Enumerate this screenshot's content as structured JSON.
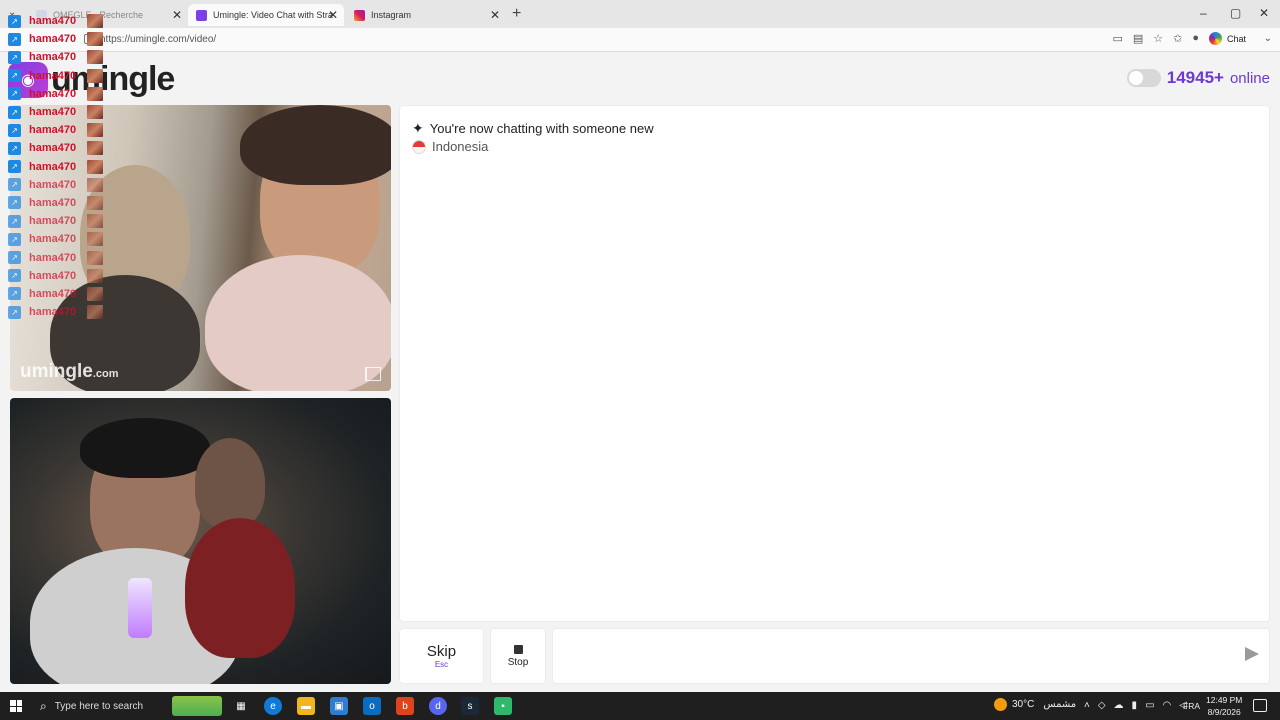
{
  "browser": {
    "tabs": [
      {
        "title": "OMEGLE - Recherche",
        "favicon": "search-icon"
      },
      {
        "title": "Umingle: Video Chat with Stra",
        "favicon": "umingle-icon"
      },
      {
        "title": "Instagram",
        "favicon": "instagram-icon"
      }
    ],
    "address": "https://umingle.com/video/",
    "copilot_label": "Chat"
  },
  "site": {
    "logo_text": "umingle",
    "online_count": "14945+",
    "online_word": "online",
    "watermark_main": "umingle",
    "watermark_suffix": ".com"
  },
  "chat": {
    "status_message": "You're now chatting with someone new",
    "country": "Indonesia",
    "message_placeholder": ""
  },
  "controls": {
    "skip_label": "Skip",
    "skip_hint": "Esc",
    "stop_label": "Stop"
  },
  "overlay": {
    "username": "hama470",
    "repeat_count": 17
  },
  "taskbar": {
    "search_placeholder": "Type here to search",
    "temperature": "30°C",
    "weather_text": "مشمس",
    "language": "FRA",
    "time": "12:49 PM",
    "date": "8/9/2026"
  },
  "colors": {
    "brand": "#6b39d6",
    "ticker_name": "#d0112b",
    "taskbar": "#1f1f1f"
  }
}
